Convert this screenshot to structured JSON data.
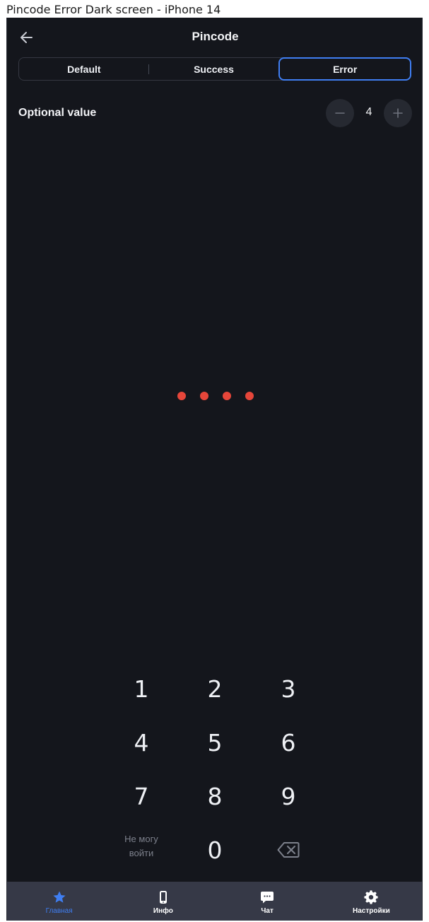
{
  "window": {
    "title": "Pincode Error Dark screen - iPhone 14"
  },
  "header": {
    "title": "Pincode"
  },
  "segments": [
    {
      "label": "Default",
      "active": false
    },
    {
      "label": "Success",
      "active": false
    },
    {
      "label": "Error",
      "active": true
    }
  ],
  "optional": {
    "label": "Optional value",
    "value": "4"
  },
  "pin": {
    "length": 4,
    "filled": 4,
    "state": "error",
    "dot_color": "#e6463a"
  },
  "keypad": {
    "keys": [
      "1",
      "2",
      "3",
      "4",
      "5",
      "6",
      "7",
      "8",
      "9",
      "0"
    ],
    "forgot_line1": "Не могу",
    "forgot_line2": "войти"
  },
  "tabbar": {
    "items": [
      {
        "label": "Главная",
        "icon": "star-icon",
        "active": true
      },
      {
        "label": "Инфо",
        "icon": "phone-icon",
        "active": false
      },
      {
        "label": "Чат",
        "icon": "chat-icon",
        "active": false
      },
      {
        "label": "Настройки",
        "icon": "gear-icon",
        "active": false
      }
    ]
  },
  "colors": {
    "background": "#14161c",
    "accent": "#3f7ef2",
    "error": "#e6463a",
    "tabbar": "#363947"
  }
}
